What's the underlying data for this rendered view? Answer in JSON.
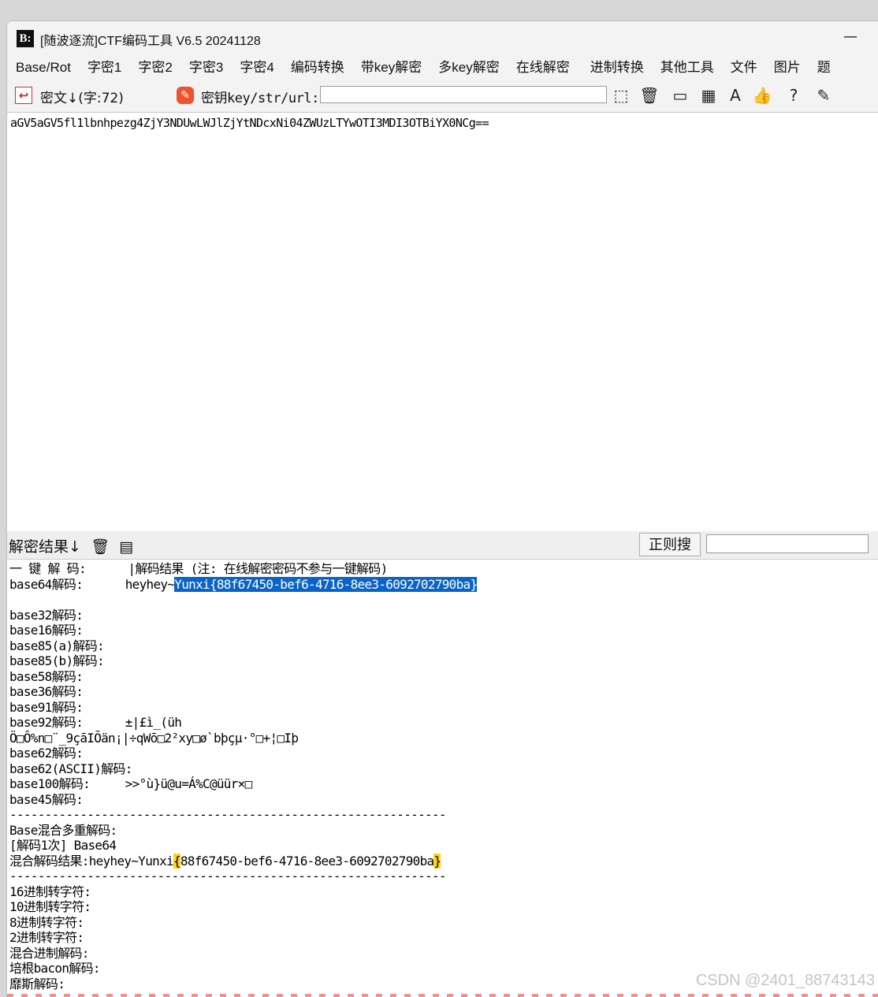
{
  "window": {
    "title": "[随波逐流]CTF编码工具 V6.5 20241128",
    "logo_text": "B:",
    "minimize_symbol": "—"
  },
  "menu": [
    "Base/Rot",
    "字密1",
    "字密2",
    "字密3",
    "字密4",
    "编码转换",
    "带key解密",
    "多key解密",
    "在线解密",
    "进制转换",
    "其他工具",
    "文件",
    "图片",
    "题"
  ],
  "toolbar": {
    "cipher_label": "密文↓(字:72)",
    "key_label": "密钥key/str/url:",
    "key_value": "",
    "icons": [
      "cursor-select-icon",
      "trash-icon",
      "terminal-icon",
      "table-icon",
      "font-icon",
      "thumbs-up-icon",
      "help-icon",
      "edit-icon"
    ]
  },
  "cipher_text": "aGV5aGV5fl1lbnhpezg4ZjY3NDUwLWJlZjYtNDcxNi04ZWUzLTYwOTI3MDI3OTBiYX0NCg==",
  "results_bar": {
    "label": "解密结果↓",
    "regex_button": "正则搜",
    "regex_value": ""
  },
  "results": {
    "line1_label": "一 键 解 码:",
    "line1_value": "|解码结果 (注: 在线解密密码不参与一键解码)",
    "b64_label": "base64解码:",
    "b64_prefix": "heyhey~",
    "b64_selected": "Yunxi{88f67450-bef6-4716-8ee3-6092702790ba}",
    "lines_a": [
      "",
      "base32解码:",
      "base16解码:",
      "base85(a)解码:",
      "base85(b)解码:",
      "base58解码:",
      "base36解码:",
      "base91解码:"
    ],
    "b92_label": "base92解码:",
    "b92_value": "±|£ì_(üh",
    "garbled_line": "Ö□Ô%n□¨_9çāIÕän¡|÷qWō□2²xy□ø`bþçµ·°□+¦□Iþ",
    "lines_b": [
      "base62解码:",
      "base62(ASCII)解码:"
    ],
    "b100_label": "base100解码:",
    "b100_value": ">>°ù}ü@u=Á%C@üür×□",
    "lines_c": [
      "base45解码:",
      "--------------------------------------------------------------",
      "Base混合多重解码:",
      "[解码1次] Base64"
    ],
    "mix_label": "混合解码结果:",
    "mix_prefix": "heyhey~Yunxi",
    "mix_open": "{",
    "mix_body": "88f67450-bef6-4716-8ee3-6092702790ba",
    "mix_close": "}",
    "lines_d": [
      "--------------------------------------------------------------",
      "16进制转字符:",
      "10进制转字符:",
      "8进制转字符:",
      "2进制转字符:",
      "混合进制解码:",
      "培根bacon解码:",
      "靡斯解码:"
    ]
  },
  "watermark": "CSDN @2401_88743143"
}
